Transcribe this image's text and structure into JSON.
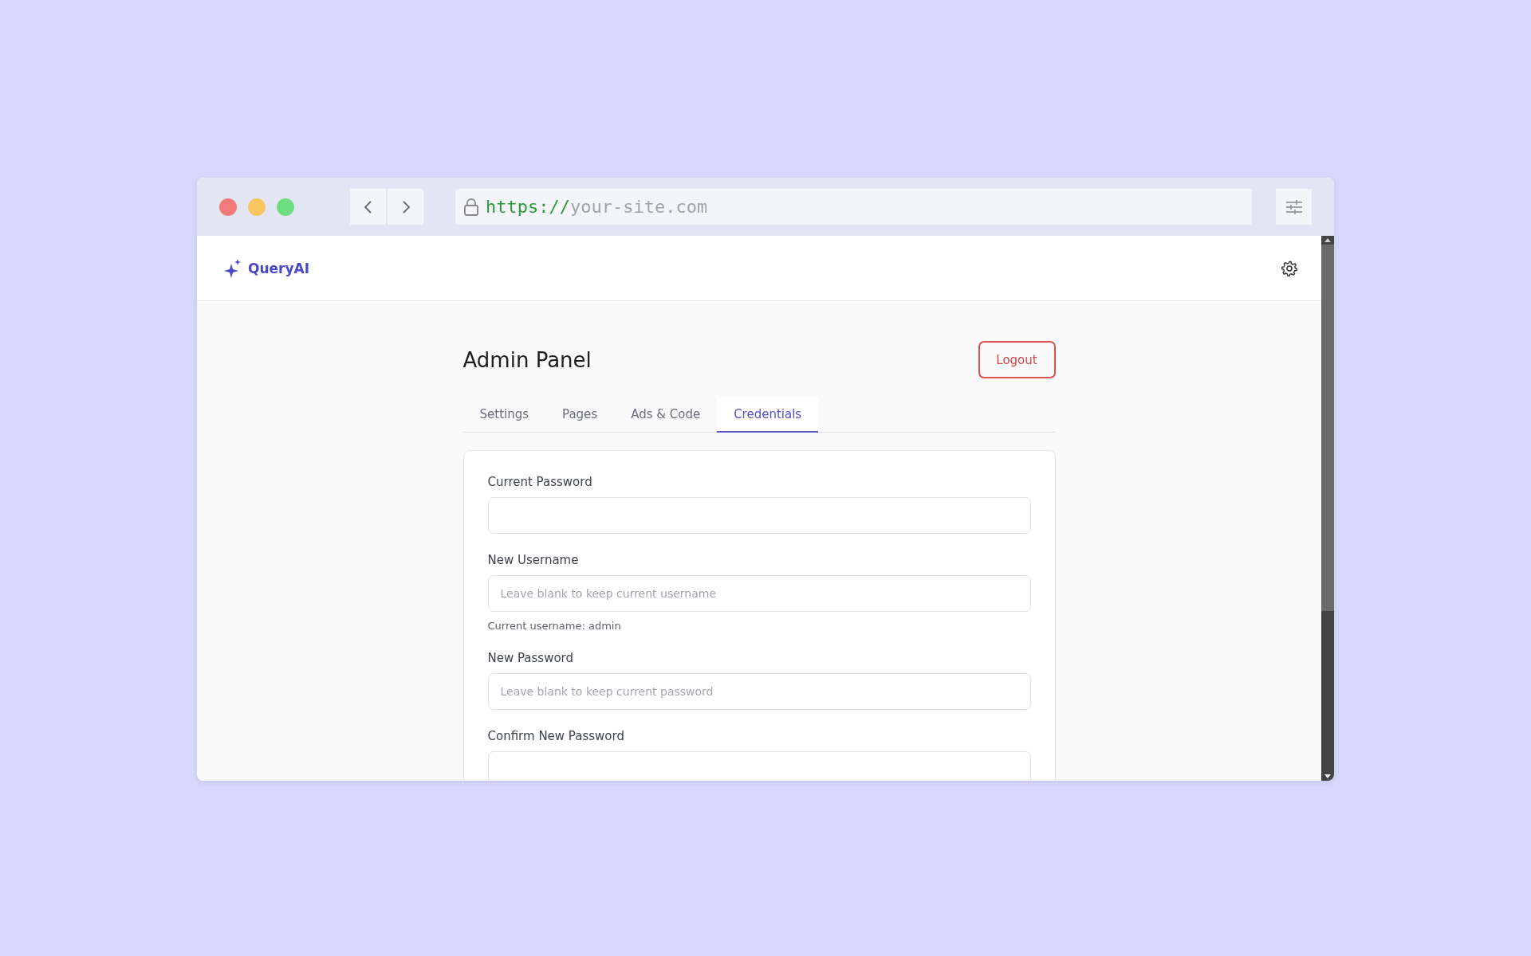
{
  "browser": {
    "url_scheme": "https://",
    "url_host": "your-site.com"
  },
  "header": {
    "brand": "QueryAI"
  },
  "page": {
    "title": "Admin Panel",
    "logout": "Logout"
  },
  "tabs": [
    {
      "label": "Settings",
      "selected": false
    },
    {
      "label": "Pages",
      "selected": false
    },
    {
      "label": "Ads & Code",
      "selected": false
    },
    {
      "label": "Credentials",
      "selected": true
    }
  ],
  "form": {
    "fields": [
      {
        "label": "Current Password"
      },
      {
        "label": "New Username",
        "placeholder": "Leave blank to keep current username",
        "hint": "Current username: admin"
      },
      {
        "label": "New Password",
        "placeholder": "Leave blank to keep current password"
      },
      {
        "label": "Confirm New Password"
      }
    ]
  }
}
